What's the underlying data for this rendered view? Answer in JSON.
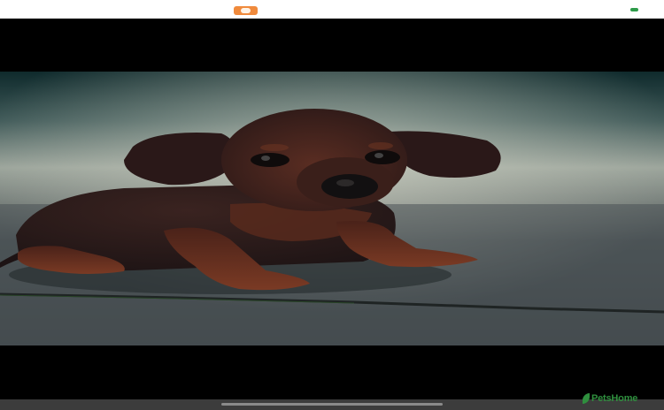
{
  "watermark": {
    "text": "PetsHome"
  },
  "icons": {
    "app_badge": "heart-badge-icon",
    "status": "battery-icon",
    "watermark_logo": "leaf-logo-icon"
  },
  "colors": {
    "badge": "#f08a3c",
    "status": "#2e9b4a",
    "watermark": "#2f8f3e",
    "letterbox": "#000000"
  },
  "photo": {
    "subject": "dachshund-puppy"
  }
}
